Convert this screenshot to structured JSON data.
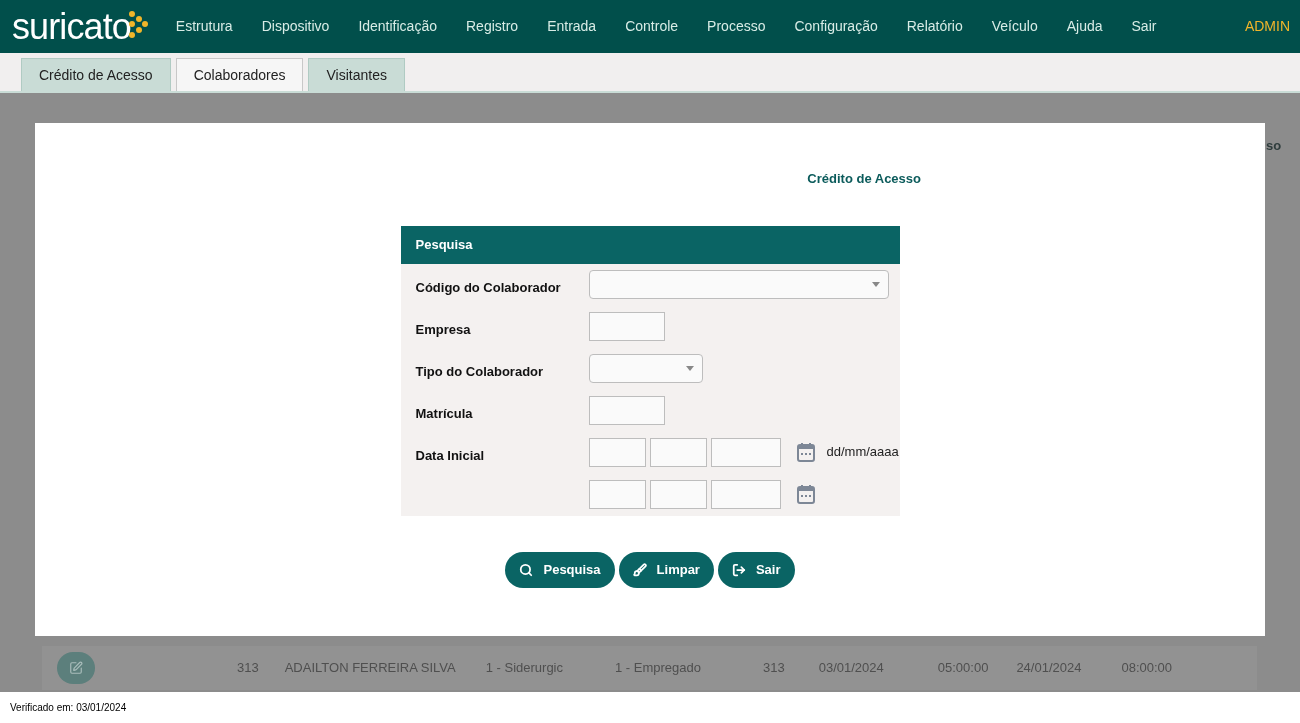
{
  "header": {
    "logo": "suricato",
    "menu": [
      "Estrutura",
      "Dispositivo",
      "Identificação",
      "Registro",
      "Entrada",
      "Controle",
      "Processo",
      "Configuração",
      "Relatório",
      "Veículo",
      "Ajuda",
      "Sair"
    ],
    "user": "ADMIN"
  },
  "tabs": [
    {
      "label": "Crédito de Acesso",
      "selected": false
    },
    {
      "label": "Colaboradores",
      "selected": true
    },
    {
      "label": "Visitantes",
      "selected": false
    }
  ],
  "background_fragment": "so",
  "background_row": {
    "cells": [
      "313",
      "ADAILTON FERREIRA SILVA",
      "1 - Siderurgic",
      "1 - Empregado",
      "313",
      "03/01/2024",
      "05:00:00",
      "24/01/2024",
      "08:00:00"
    ]
  },
  "modal": {
    "title": "Crédito de Acesso",
    "panel": {
      "title": "Pesquisa",
      "fields": [
        {
          "label": "Código do Colaborador",
          "kind": "combo"
        },
        {
          "label": "Empresa",
          "kind": "text"
        },
        {
          "label": "Tipo do Colaborador",
          "kind": "select"
        },
        {
          "label": "Matrícula",
          "kind": "text"
        },
        {
          "label": "Data Inicial",
          "kind": "date",
          "hint": "dd/mm/aaaa"
        },
        {
          "kind": "date"
        }
      ]
    },
    "buttons": [
      {
        "label": "Pesquisa",
        "kind": "search"
      },
      {
        "label": "Limpar",
        "kind": "clear"
      },
      {
        "label": "Sair",
        "kind": "exit"
      }
    ]
  },
  "footer": "Verificado em: 03/01/2024"
}
